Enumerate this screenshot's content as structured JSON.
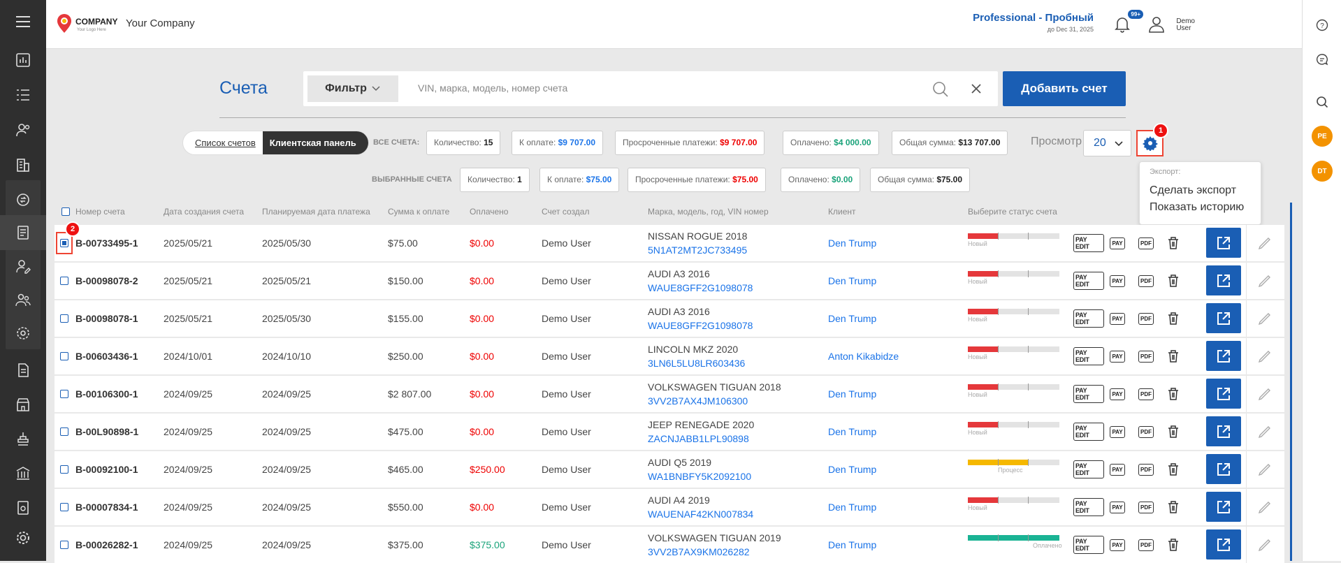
{
  "header": {
    "logo_text": "COMPANY",
    "logo_sub": "Your Logo Here",
    "company_name": "Your Company",
    "plan": "Professional - Пробный",
    "plan_until": "до Dec 31, 2025",
    "notifications": "99+",
    "user_line1": "Demo",
    "user_line2": "User"
  },
  "page": {
    "title": "Счета",
    "filter_label": "Фильтр",
    "search_placeholder": "VIN, марка, модель, номер счета",
    "add_button": "Добавить счет"
  },
  "toggle": {
    "list": "Список счетов",
    "panel": "Клиентская панель"
  },
  "all_label": "ВСЕ СЧЕТА:",
  "all_stats": [
    {
      "label": "Количество:",
      "value": "15",
      "color": "blk"
    },
    {
      "label": "К оплате:",
      "value": "$9 707.00",
      "color": "blue"
    },
    {
      "label": "Просроченные платежи:",
      "value": "$9 707.00",
      "color": "red"
    },
    {
      "label": "Оплачено:",
      "value": "$4 000.00",
      "color": "green"
    },
    {
      "label": "Общая сумма:",
      "value": "$13 707.00",
      "color": "blk"
    }
  ],
  "selected_label": "ВЫБРАННЫЕ СЧЕТА",
  "selected_stats": [
    {
      "label": "Количество:",
      "value": "1",
      "color": "blk"
    },
    {
      "label": "К оплате:",
      "value": "$75.00",
      "color": "blue"
    },
    {
      "label": "Просроченные платежи:",
      "value": "$75.00",
      "color": "red"
    },
    {
      "label": "Оплачено:",
      "value": "$0.00",
      "color": "green"
    },
    {
      "label": "Общая сумма:",
      "value": "$75.00",
      "color": "blk"
    }
  ],
  "view": {
    "label": "Просмотр",
    "value": "20"
  },
  "badges": {
    "gear": "1",
    "checkbox": "2"
  },
  "export_menu": {
    "title": "Экспорт:",
    "items": [
      "Сделать экспорт",
      "Показать историю"
    ]
  },
  "columns": [
    "Номер счета",
    "Дата создания счета",
    "Планируемая дата платежа",
    "Сумма к оплате",
    "Оплачено",
    "Счет создал",
    "Марка, модель, год, VIN номер",
    "Клиент",
    "Выберите статус счета"
  ],
  "row_icons": {
    "pay_edit": "PAY EDIT",
    "pay": "PAY",
    "pdf": "PDF"
  },
  "rows": [
    {
      "num": "B-00733495-1",
      "created": "2025/05/21",
      "planned": "2025/05/30",
      "sum": "$75.00",
      "paid": "$0.00",
      "paid_color": "#e00",
      "by": "Demo User",
      "car": "NISSAN ROGUE 2018",
      "vin": "5N1AT2MT2JC733495",
      "client": "Den Trump",
      "status": "Новый",
      "progress": 0.33,
      "bar_color": "#e5383b",
      "checked": true
    },
    {
      "num": "B-00098078-2",
      "created": "2025/05/21",
      "planned": "2025/05/21",
      "sum": "$150.00",
      "paid": "$0.00",
      "paid_color": "#e00",
      "by": "Demo User",
      "car": "AUDI A3 2016",
      "vin": "WAUE8GFF2G1098078",
      "client": "Den Trump",
      "status": "Новый",
      "progress": 0.33,
      "bar_color": "#e5383b",
      "checked": false
    },
    {
      "num": "B-00098078-1",
      "created": "2025/05/21",
      "planned": "2025/05/30",
      "sum": "$155.00",
      "paid": "$0.00",
      "paid_color": "#e00",
      "by": "Demo User",
      "car": "AUDI A3 2016",
      "vin": "WAUE8GFF2G1098078",
      "client": "Den Trump",
      "status": "Новый",
      "progress": 0.33,
      "bar_color": "#e5383b",
      "checked": false
    },
    {
      "num": "B-00603436-1",
      "created": "2024/10/01",
      "planned": "2024/10/10",
      "sum": "$250.00",
      "paid": "$0.00",
      "paid_color": "#e00",
      "by": "Demo User",
      "car": "LINCOLN MKZ 2020",
      "vin": "3LN6L5LU8LR603436",
      "client": "Anton Kikabidze",
      "status": "Новый",
      "progress": 0.33,
      "bar_color": "#e5383b",
      "checked": false
    },
    {
      "num": "B-00106300-1",
      "created": "2024/09/25",
      "planned": "2024/09/25",
      "sum": "$2 807.00",
      "paid": "$0.00",
      "paid_color": "#e00",
      "by": "Demo User",
      "car": "VOLKSWAGEN TIGUAN 2018",
      "vin": "3VV2B7AX4JM106300",
      "client": "Den Trump",
      "status": "Новый",
      "progress": 0.33,
      "bar_color": "#e5383b",
      "checked": false
    },
    {
      "num": "B-00L90898-1",
      "created": "2024/09/25",
      "planned": "2024/09/25",
      "sum": "$475.00",
      "paid": "$0.00",
      "paid_color": "#e00",
      "by": "Demo User",
      "car": "JEEP RENEGADE 2020",
      "vin": "ZACNJABB1LPL90898",
      "client": "Den Trump",
      "status": "Новый",
      "progress": 0.33,
      "bar_color": "#e5383b",
      "checked": false
    },
    {
      "num": "B-00092100-1",
      "created": "2024/09/25",
      "planned": "2024/09/25",
      "sum": "$465.00",
      "paid": "$250.00",
      "paid_color": "#e00",
      "by": "Demo User",
      "car": "AUDI Q5 2019",
      "vin": "WA1BNBFY5K2092100",
      "client": "Den Trump",
      "status": "Процесс",
      "progress": 0.66,
      "bar_color": "#f5b800",
      "checked": false
    },
    {
      "num": "B-00007834-1",
      "created": "2024/09/25",
      "planned": "2024/09/25",
      "sum": "$550.00",
      "paid": "$0.00",
      "paid_color": "#e00",
      "by": "Demo User",
      "car": "AUDI A4 2019",
      "vin": "WAUENAF42KN007834",
      "client": "Den Trump",
      "status": "Новый",
      "progress": 0.33,
      "bar_color": "#e5383b",
      "checked": false
    },
    {
      "num": "B-00026282-1",
      "created": "2024/09/25",
      "planned": "2024/09/25",
      "sum": "$375.00",
      "paid": "$375.00",
      "paid_color": "#1aa37a",
      "by": "Demo User",
      "car": "VOLKSWAGEN TIGUAN 2019",
      "vin": "3VV2B7AX9KM026282",
      "client": "Den Trump",
      "status": "Оплачено",
      "progress": 1.0,
      "bar_color": "#1ab394",
      "checked": false
    }
  ],
  "right_avatars": [
    "PE",
    "DT"
  ]
}
